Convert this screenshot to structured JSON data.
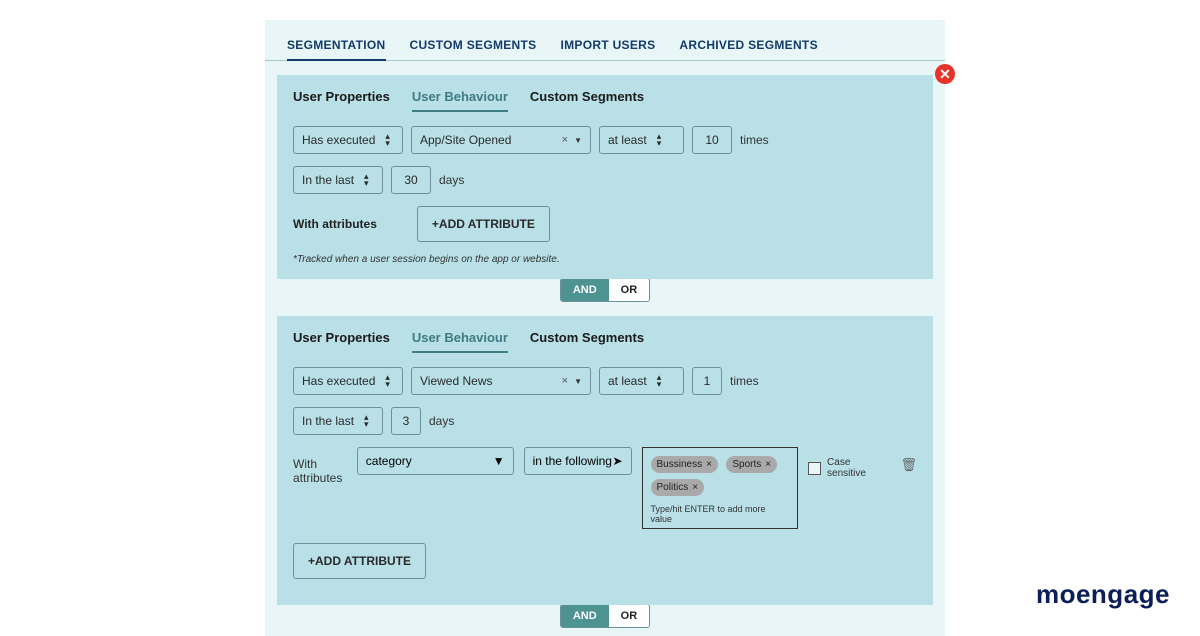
{
  "nav": {
    "tabs": [
      "SEGMENTATION",
      "CUSTOM SEGMENTS",
      "IMPORT USERS",
      "ARCHIVED SEGMENTS"
    ],
    "active": 0
  },
  "close": "✕",
  "filter_tabs": {
    "user_properties": "User Properties",
    "user_behaviour": "User Behaviour",
    "user_behaviour_spaced": "User  Behaviour",
    "custom_segments": "Custom Segments"
  },
  "block1": {
    "has_executed": "Has executed",
    "event": "App/Site Opened",
    "comparator": "at least",
    "count": "10",
    "times": "times",
    "range": "In the last",
    "range_val": "30",
    "range_unit": "days",
    "with_attr": "With attributes",
    "add_attr": "+ADD ATTRIBUTE",
    "footnote": "*Tracked when a user session begins on the app or website."
  },
  "andor": {
    "and": "AND",
    "or": "OR"
  },
  "block2": {
    "has_executed": "Has executed",
    "event": "Viewed News",
    "comparator": "at least",
    "count": "1",
    "times": "times",
    "range": "In the last",
    "range_val": "3",
    "range_unit": "days",
    "with_attr": "With attributes",
    "attr_name": "category",
    "operator": "in the following",
    "chips": [
      "Bussiness",
      "Sports",
      "Politics"
    ],
    "chips_hint": "Type/hit ENTER to add more value",
    "case_sensitive": "Case sensitive",
    "add_attr": "+ADD ATTRIBUTE"
  },
  "brand": "moengage"
}
